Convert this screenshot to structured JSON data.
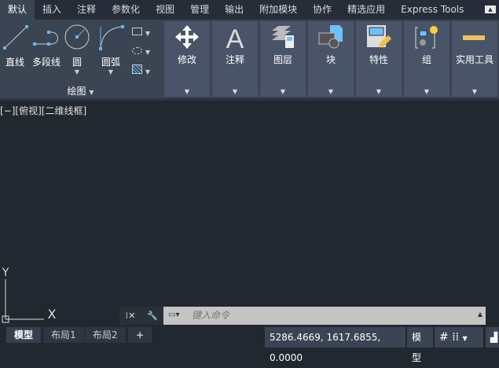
{
  "tabs": [
    "默认",
    "插入",
    "注释",
    "参数化",
    "视图",
    "管理",
    "输出",
    "附加模块",
    "协作",
    "精选应用",
    "Express Tools"
  ],
  "draw": {
    "line": "直线",
    "polyline": "多段线",
    "circle": "圆",
    "arc": "圆弧",
    "panel_title": "绘图"
  },
  "panels": [
    "修改",
    "注释",
    "图层",
    "块",
    "特性",
    "组",
    "实用工具"
  ],
  "viewport_label": "[−][俯视][二维线框]",
  "command": {
    "placeholder": "键入命令"
  },
  "ucs": {
    "x": "X",
    "y": "Y"
  },
  "layout_tabs": [
    "模型",
    "布局1",
    "布局2",
    "+"
  ],
  "status": {
    "coords": "5286.4669, 1617.6855, 0.0000",
    "model": "模型"
  }
}
